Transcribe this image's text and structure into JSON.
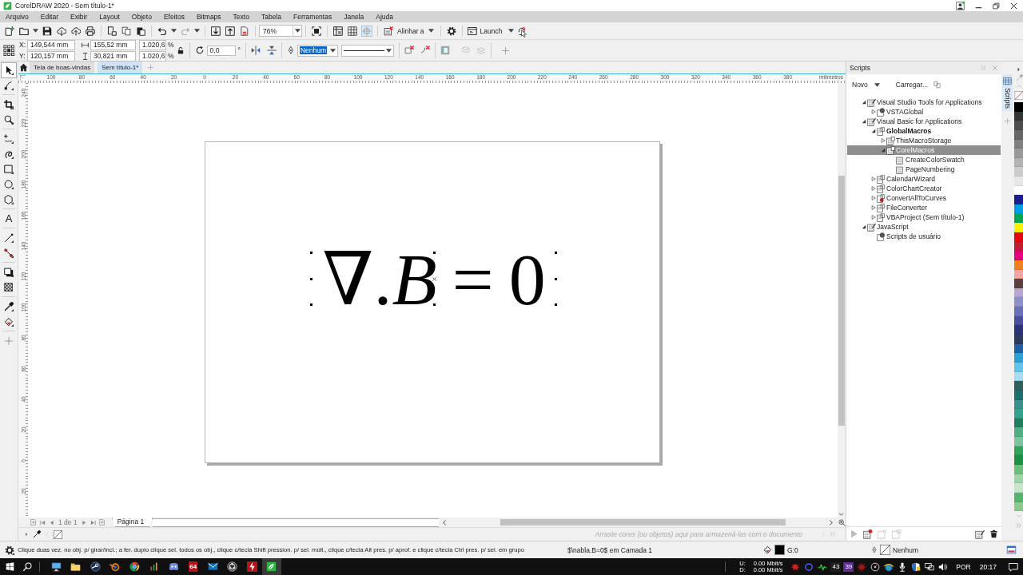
{
  "window": {
    "title": "CorelDRAW 2020 - Sem título-1*"
  },
  "menu": [
    "Arquivo",
    "Editar",
    "Exibir",
    "Layout",
    "Objeto",
    "Efeitos",
    "Bitmaps",
    "Texto",
    "Tabela",
    "Ferramentas",
    "Janela",
    "Ajuda"
  ],
  "standard_toolbar": {
    "zoom_level": "76%",
    "align_menu": "Alinhar a",
    "launch_menu": "Launch"
  },
  "property_bar": {
    "x_label": "X:",
    "x_value": "149,544 mm",
    "y_label": "Y:",
    "y_value": "120,157 mm",
    "width_value": "155,52 mm",
    "height_value": "30,821 mm",
    "scale": [
      {
        "value": "1.020,6",
        "unit": "%"
      },
      {
        "value": "1.020,6",
        "unit": "%"
      }
    ],
    "rotation_value": "0,0",
    "degree_sign": "°",
    "outline_width": {
      "value": "Nenhum",
      "highlighted": true
    }
  },
  "toolbox": [
    {
      "kind": "pick",
      "selected": true
    },
    {
      "kind": "shape",
      "selected": false
    },
    {
      "kind": "crop",
      "selected": false
    },
    {
      "kind": "zoom",
      "selected": false
    },
    {
      "kind": "freehand",
      "selected": false
    },
    {
      "kind": "artistic",
      "selected": false
    },
    {
      "kind": "rectangle",
      "selected": false
    },
    {
      "kind": "ellipse",
      "selected": false
    },
    {
      "kind": "polygon",
      "selected": false
    },
    {
      "kind": "text",
      "glyph": "A",
      "selected": false
    },
    {
      "kind": "line",
      "selected": false
    },
    {
      "kind": "connector",
      "selected": false
    },
    {
      "kind": "shadow",
      "selected": false
    },
    {
      "kind": "transparency",
      "selected": false
    },
    {
      "kind": "eyedropper",
      "selected": false
    },
    {
      "kind": "fill",
      "selected": false
    },
    {
      "kind": "add",
      "selected": false
    }
  ],
  "document_tabs": [
    {
      "label": "Tela de boas-vindas",
      "kind": "home",
      "selected": false
    },
    {
      "label": "Sem título-1*",
      "kind": "document",
      "selected": true
    }
  ],
  "rulers": {
    "horizontal": [
      "100",
      "80",
      "60",
      "40",
      "20",
      "0",
      "20",
      "40",
      "60",
      "80",
      "100",
      "120",
      "140",
      "160",
      "180",
      "200",
      "220",
      "240",
      "260",
      "280",
      "300",
      "320",
      "340",
      "360",
      "380"
    ],
    "unit": "milímetros",
    "vertical": [
      "240",
      "220",
      "200",
      "180",
      "160",
      "140",
      "120",
      "100",
      "80",
      "60",
      "40",
      "20",
      "0",
      "20"
    ]
  },
  "canvas": {
    "equation": "∇.*B* = 0",
    "selected": true
  },
  "page_navigator": {
    "position": "1 de 1",
    "page_tab": "Página 1"
  },
  "document_palette": {
    "hint": "Arraste cores (ou objetos) aqui para armazená-las com o documento"
  },
  "scripts_docker": {
    "title": "Scripts",
    "new_button": "Novo",
    "load_button": "Carregar...",
    "tree": [
      {
        "label": "Visual Studio Tools for Applications",
        "kind": "category",
        "expanded": true,
        "selected": false,
        "children": [
          {
            "label": "VSTAGlobal",
            "kind": "gear",
            "expanded": false,
            "selected": false
          }
        ]
      },
      {
        "label": "Visual Basic for Applications",
        "kind": "category",
        "expanded": true,
        "selected": false,
        "children": [
          {
            "label": "GlobalMacros",
            "kind": "global",
            "expanded": true,
            "selected": false,
            "children": [
              {
                "label": "ThisMacroStorage",
                "kind": "module",
                "expanded": false,
                "selected": false
              },
              {
                "label": "CorelMacros",
                "kind": "module",
                "expanded": true,
                "selected": true,
                "children": [
                  {
                    "label": "CreateColorSwatch",
                    "kind": "macro",
                    "selected": false
                  },
                  {
                    "label": "PageNumbering",
                    "kind": "macro",
                    "selected": false
                  }
                ]
              }
            ]
          },
          {
            "label": "CalendarWizard",
            "kind": "project",
            "expanded": false,
            "selected": false
          },
          {
            "label": "ColorChartCreator",
            "kind": "project",
            "expanded": false,
            "selected": false
          },
          {
            "label": "ConvertAllToCurves",
            "kind": "locked-project",
            "expanded": false,
            "selected": false
          },
          {
            "label": "FileConverter",
            "kind": "project",
            "expanded": false,
            "selected": false
          },
          {
            "label": "VBAProject (Sem título-1)",
            "kind": "project",
            "expanded": false,
            "selected": false
          }
        ]
      },
      {
        "label": "JavaScript",
        "kind": "category",
        "expanded": true,
        "selected": false,
        "children": [
          {
            "label": "Scripts de usuário",
            "kind": "gear",
            "selected": false
          }
        ]
      }
    ]
  },
  "side_tabs": [
    {
      "label": "Scripts",
      "selected": true
    }
  ],
  "color_palette": [
    {
      "color": "#000000"
    },
    {
      "color": "#333333"
    },
    {
      "color": "#4d4d4d"
    },
    {
      "color": "#666666"
    },
    {
      "color": "#808080"
    },
    {
      "color": "#999999"
    },
    {
      "color": "#b3b3b3"
    },
    {
      "color": "#cccccc"
    },
    {
      "color": "#e6e6e6"
    },
    {
      "color": "#ffffff"
    },
    {
      "color": "#1d1d8f"
    },
    {
      "color": "#009fe3"
    },
    {
      "color": "#00a651"
    },
    {
      "color": "#fff200"
    },
    {
      "color": "#e30613"
    },
    {
      "color": "#be1e2d"
    },
    {
      "color": "#e6007e"
    },
    {
      "color": "#f07f1c"
    },
    {
      "color": "#f4a3a0"
    },
    {
      "color": "#5b3f3f"
    },
    {
      "color": "#b7a6d2"
    },
    {
      "color": "#8f8fc8"
    },
    {
      "color": "#6b6fb5"
    },
    {
      "color": "#4a4f9e"
    },
    {
      "color": "#2e3173"
    },
    {
      "color": "#293b5f"
    },
    {
      "color": "#1f5fa8"
    },
    {
      "color": "#2a9fd6"
    },
    {
      "color": "#62c3e8"
    },
    {
      "color": "#a6dcef"
    },
    {
      "color": "#2e5e5e"
    },
    {
      "color": "#1f6e6e"
    },
    {
      "color": "#3a8f8f"
    },
    {
      "color": "#33a18b"
    },
    {
      "color": "#1e7f5c"
    },
    {
      "color": "#4fae84"
    },
    {
      "color": "#7cc49c"
    },
    {
      "color": "#2fa35a"
    },
    {
      "color": "#1f8f45"
    },
    {
      "color": "#6cbf7a"
    },
    {
      "color": "#9fd3a8"
    },
    {
      "color": "#c5e6c8"
    },
    {
      "color": "#57b26a"
    },
    {
      "color": "#8cc98f"
    }
  ],
  "status_bar": {
    "hint": "Clique duas vez. no obj. p/ girar/incl.; a fer. duplo clique sel. todos os obj., clique c/tecla Shift pression. p/ sel. múlt., clique c/tecla Alt pres. p/ aprof. e clique c/tecla Ctrl pres. p/ sel. em grupo",
    "object_info": "$\\nabla.B=0$ em Camada 1",
    "fill": {
      "color": "#000000",
      "label": "G:0"
    },
    "outline": {
      "label": "Nenhum"
    }
  },
  "taskbar": {
    "apps": [
      {
        "kind": "monitor",
        "active": false
      },
      {
        "kind": "folder",
        "active": false
      },
      {
        "kind": "steam",
        "active": false
      },
      {
        "kind": "blender",
        "active": false
      },
      {
        "kind": "chrome",
        "active": false
      },
      {
        "kind": "chart",
        "active": false
      },
      {
        "kind": "discord",
        "active": false
      },
      {
        "kind": "tile",
        "label": "64",
        "active": false
      },
      {
        "kind": "mail",
        "active": false
      },
      {
        "kind": "obs",
        "active": false
      },
      {
        "kind": "bolt",
        "active": false
      },
      {
        "kind": "corel",
        "active": true
      }
    ],
    "network": {
      "upload_label": "U:",
      "download_label": "D:",
      "upload": "0.00 Mbit/s",
      "download": "0.00 Mbit/s"
    },
    "tray": [
      {
        "kind": "burst"
      },
      {
        "kind": "ring"
      },
      {
        "kind": "pulse"
      },
      {
        "kind": "counter",
        "label": "43",
        "color": "#1e1e1e"
      },
      {
        "kind": "counter",
        "label": "39",
        "color": "#5c2d91"
      },
      {
        "kind": "virus"
      },
      {
        "kind": "gauge"
      },
      {
        "kind": "globe"
      },
      {
        "kind": "microphone"
      },
      {
        "kind": "shield"
      },
      {
        "kind": "network"
      },
      {
        "kind": "volume"
      }
    ],
    "language": "POR",
    "clock": "20:17"
  }
}
